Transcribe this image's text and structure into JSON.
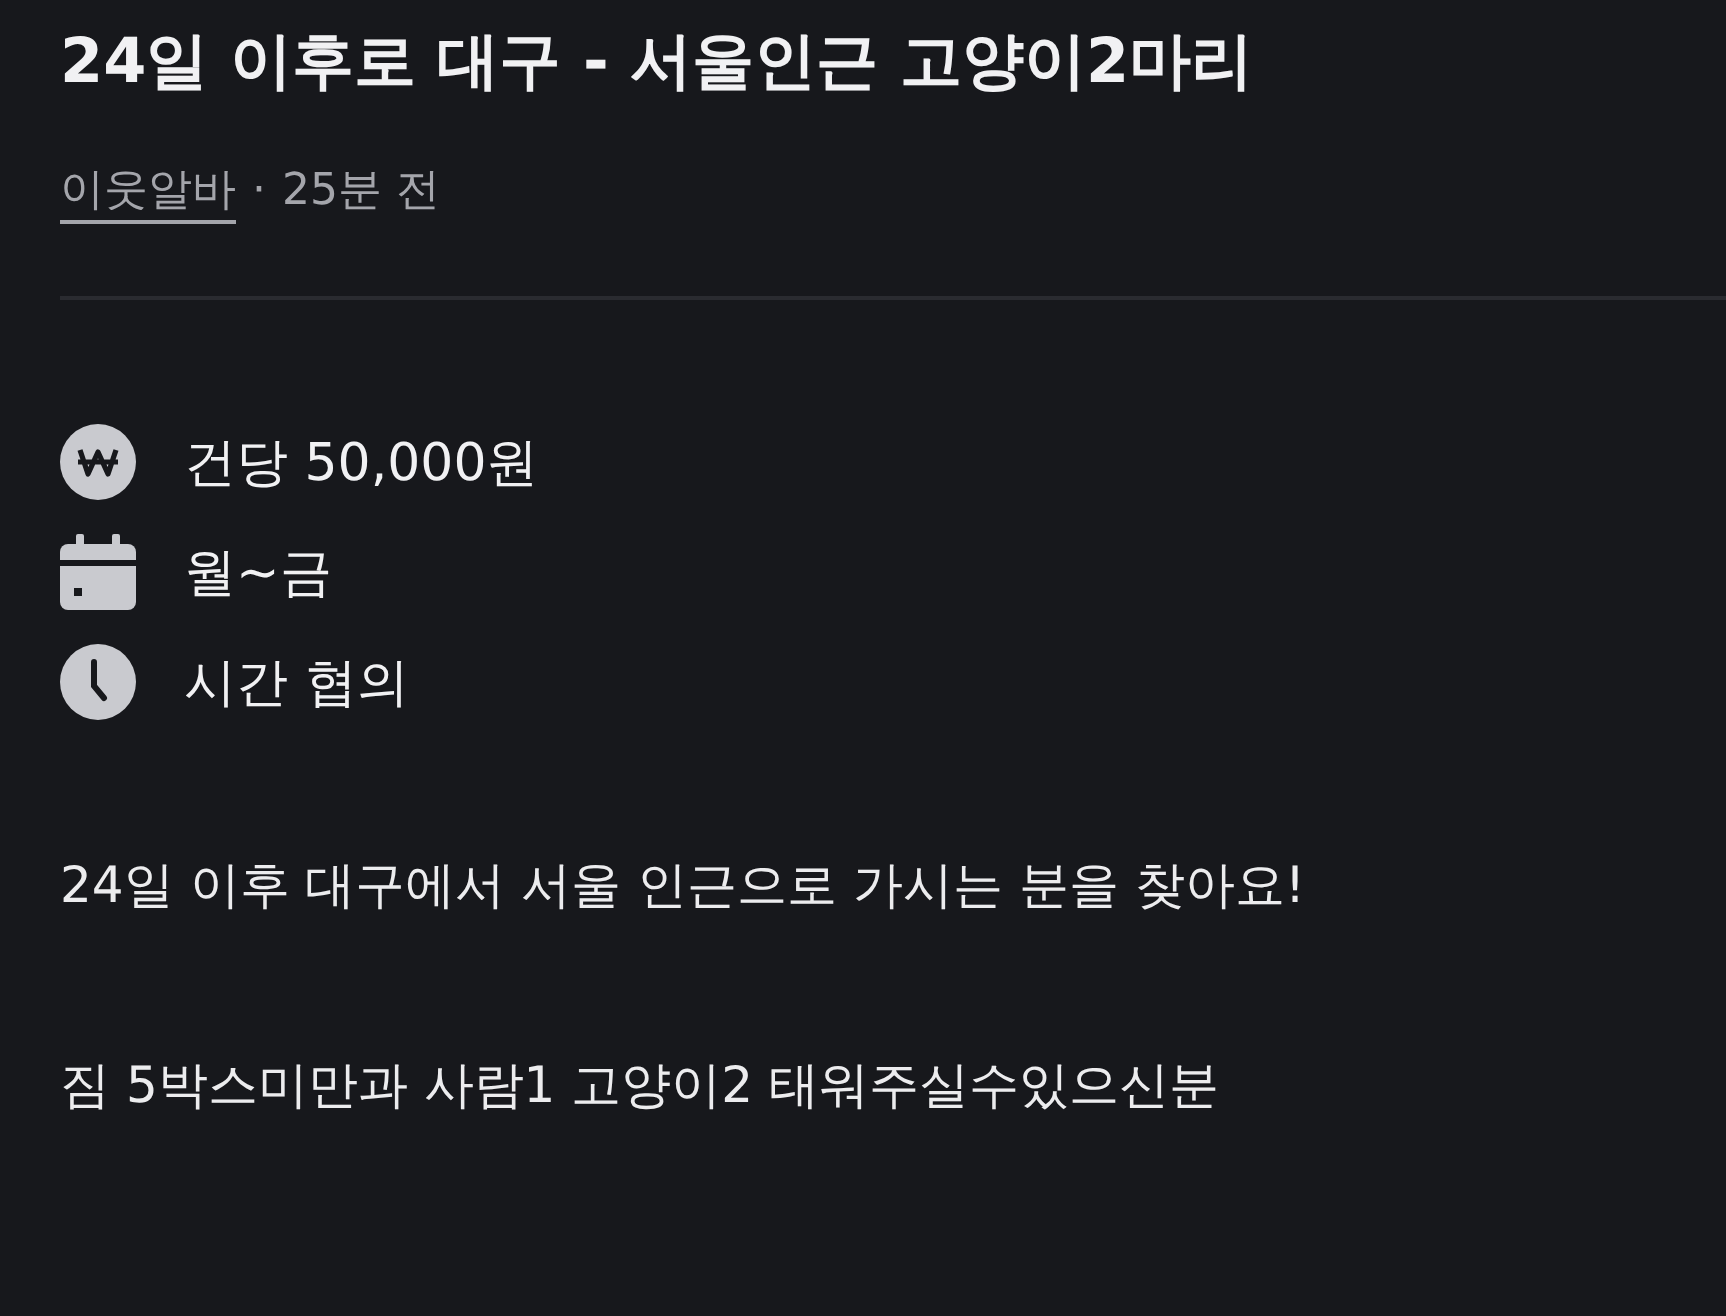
{
  "title": "24일 이후로 대구 - 서울인근 고양이2마리",
  "author": "이웃알바",
  "separator": "·",
  "time": "25분 전",
  "details": [
    {
      "kind": "pay",
      "text": "건당 50,000원"
    },
    {
      "kind": "days",
      "text": "월~금"
    },
    {
      "kind": "hours",
      "text": "시간 협의"
    }
  ],
  "body": [
    "24일 이후 대구에서 서울 인근으로 가시는 분을 찾아요!",
    "짐 5박스미만과 사람1 고양이2 태워주실수있으신분"
  ]
}
